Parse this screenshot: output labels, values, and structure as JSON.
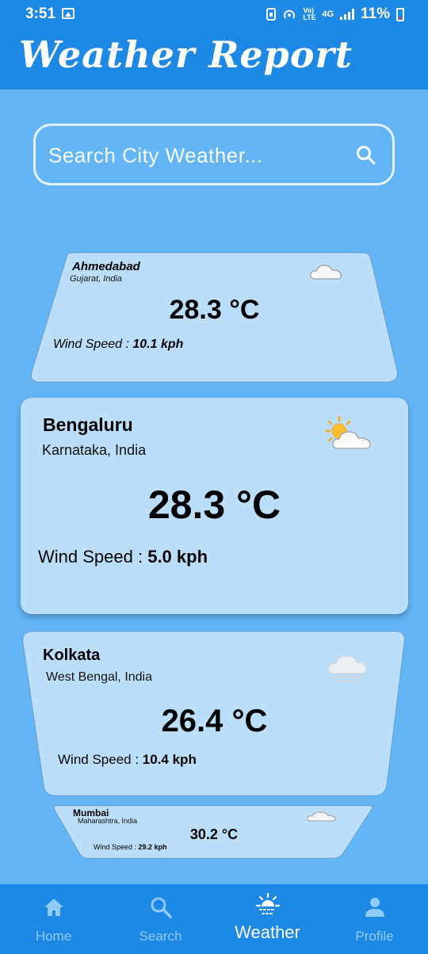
{
  "status_bar": {
    "time": "3:51",
    "network_label": "4G",
    "volte_label": "Vo) LTE",
    "battery": "11%"
  },
  "app": {
    "title": "Weather Report"
  },
  "search": {
    "placeholder": "Search City Weather..."
  },
  "cards": [
    {
      "city": "Ahmedabad",
      "region": "Gujarat, India",
      "temperature": "28.3 °C",
      "wind_label": "Wind Speed :",
      "wind_value": "10.1 kph",
      "icon": "cloud-icon"
    },
    {
      "city": "Bengaluru",
      "region": "Karnataka, India",
      "temperature": "28.3 °C",
      "wind_label": "Wind Speed :",
      "wind_value": "5.0 kph",
      "icon": "partly-cloudy-icon"
    },
    {
      "city": "Kolkata",
      "region": "West Bengal, India",
      "temperature": "26.4 °C",
      "wind_label": "Wind Speed :",
      "wind_value": "10.4 kph",
      "icon": "mist-cloud-icon"
    },
    {
      "city": "Mumbai",
      "region": "Maharashtra, India",
      "temperature": "30.2 °C",
      "wind_label": "Wind Speed :",
      "wind_value": "29.2 kph",
      "icon": "cloud-icon"
    }
  ],
  "nav": {
    "items": [
      {
        "label": "Home",
        "icon": "home-icon"
      },
      {
        "label": "Search",
        "icon": "search-icon"
      },
      {
        "label": "Weather",
        "icon": "sun-icon",
        "active": true
      },
      {
        "label": "Profile",
        "icon": "profile-icon"
      }
    ]
  },
  "colors": {
    "app_bar": "#1e88e5",
    "background": "#64b5f6",
    "card": "#bbdefb"
  }
}
